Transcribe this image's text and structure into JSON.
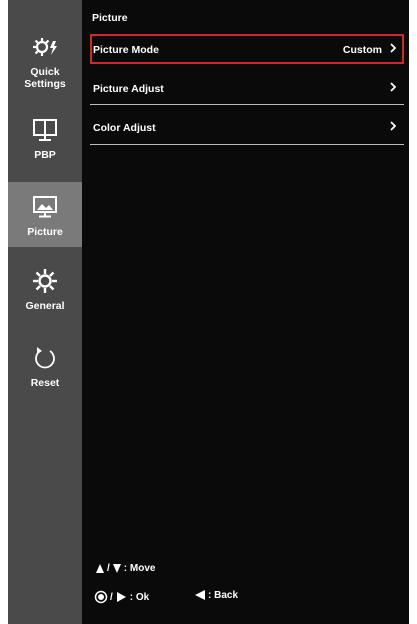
{
  "sidebar": {
    "items": [
      {
        "label": "Quick\nSettings",
        "icon": "quick-settings-icon",
        "active": false
      },
      {
        "label": "PBP",
        "icon": "pbp-icon",
        "active": false
      },
      {
        "label": "Picture",
        "icon": "picture-icon",
        "active": true
      },
      {
        "label": "General",
        "icon": "gear-icon",
        "active": false
      },
      {
        "label": "Reset",
        "icon": "reset-icon",
        "active": false
      }
    ]
  },
  "main": {
    "title": "Picture",
    "menu": [
      {
        "label": "Picture Mode",
        "value": "Custom",
        "selected": true
      },
      {
        "label": "Picture Adjust",
        "value": "",
        "selected": false
      },
      {
        "label": "Color Adjust",
        "value": "",
        "selected": false
      }
    ]
  },
  "hints": {
    "move": ": Move",
    "ok": ": Ok",
    "back": ": Back"
  },
  "colors": {
    "background": "#0a0a0a",
    "sidebar": "#4a4a4a",
    "sidebar_active": "#7a7a7a",
    "selection_border": "#d02828",
    "text": "#ffffff"
  }
}
